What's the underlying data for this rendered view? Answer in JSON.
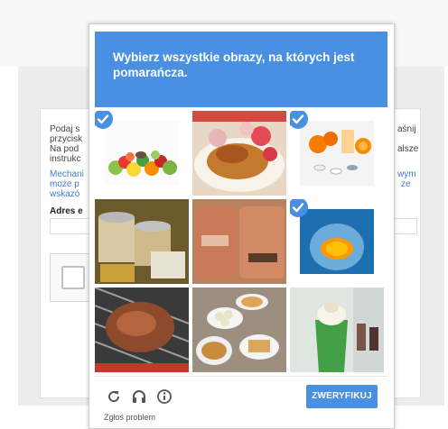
{
  "background": {
    "paragraph_lines": [
      "Podaj s",
      "przycisk",
      "Na pod",
      "instrukc"
    ],
    "paragraph_right_lines": [
      "aśnij",
      "",
      "alsze",
      ""
    ],
    "link_lines": [
      "Mechani",
      "może p",
      "wskazó"
    ],
    "link_right_lines": [
      "wym",
      "ze",
      ""
    ],
    "email_label": "Adres e"
  },
  "challenge": {
    "instruction": "Wybierz wszystkie obrazy, na których jest pomarańcza.",
    "tiles": [
      {
        "subject": "fruit assortment",
        "selected": true
      },
      {
        "subject": "fried food plate",
        "selected": false
      },
      {
        "subject": "oranges and pills",
        "selected": true
      },
      {
        "subject": "food jars",
        "selected": false
      },
      {
        "subject": "packaged snacks",
        "selected": false
      },
      {
        "subject": "orange slice in glass",
        "selected": true
      },
      {
        "subject": "grilled meat",
        "selected": false
      },
      {
        "subject": "soup and dumplings",
        "selected": false
      },
      {
        "subject": "green smoothie cup",
        "selected": false
      }
    ],
    "verify_label": "ZWERYFIKUJ",
    "report_label": "Zgłoś problem",
    "icons": [
      "reload-icon",
      "audio-icon",
      "info-icon"
    ],
    "accent_color": "#4a90e2"
  }
}
